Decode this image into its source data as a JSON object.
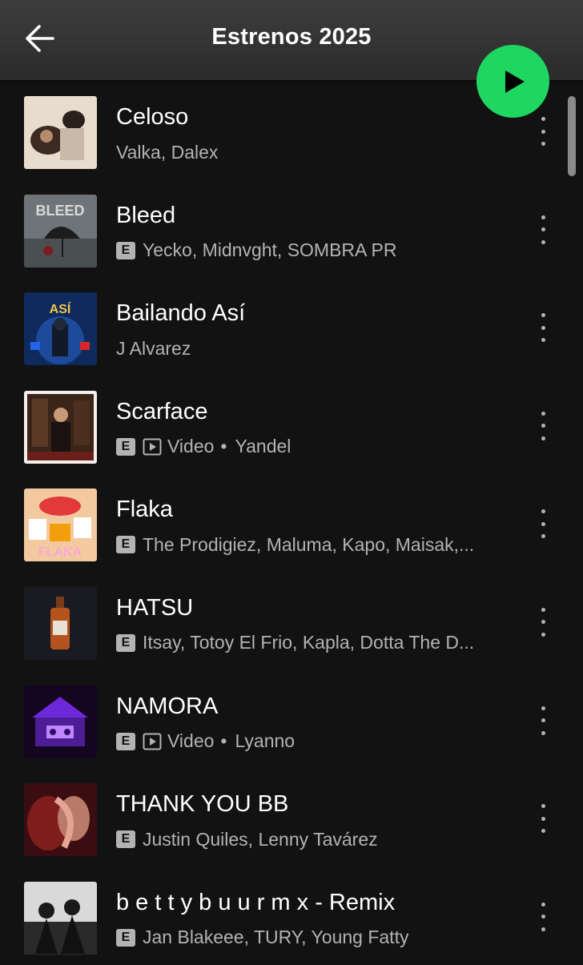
{
  "header": {
    "title": "Estrenos 2025"
  },
  "tracks": [
    {
      "title": "Celoso",
      "explicit": false,
      "video": false,
      "artists": "Valka, Dalex"
    },
    {
      "title": "Bleed",
      "explicit": true,
      "video": false,
      "artists": "Yecko, Midnvght, SOMBRA PR"
    },
    {
      "title": "Bailando Así",
      "explicit": false,
      "video": false,
      "artists": "J Alvarez"
    },
    {
      "title": "Scarface",
      "explicit": true,
      "video": true,
      "video_label": "Video",
      "artists": "Yandel"
    },
    {
      "title": "Flaka",
      "explicit": true,
      "video": false,
      "artists": "The Prodigiez, Maluma, Kapo, Maisak,..."
    },
    {
      "title": "HATSU",
      "explicit": true,
      "video": false,
      "artists": "Itsay, Totoy El Frio, Kapla, Dotta The D..."
    },
    {
      "title": "NAMORA",
      "explicit": true,
      "video": true,
      "video_label": "Video",
      "artists": "Lyanno"
    },
    {
      "title": "THANK YOU BB",
      "explicit": true,
      "video": false,
      "artists": "Justin Quiles, Lenny Tavárez"
    },
    {
      "title": "b e t t y b u u r m x - Remix",
      "explicit": true,
      "video": false,
      "artists": "Jan Blakeee, TURY, Young Fatty"
    }
  ],
  "labels": {
    "explicit": "E",
    "separator": "•"
  },
  "colors": {
    "accent": "#1ed760",
    "background": "#121212",
    "secondary_text": "#b3b3b3"
  },
  "icons": {
    "back": "arrow-left-icon",
    "play": "play-icon",
    "more": "more-vertical-icon",
    "video": "video-play-icon"
  }
}
